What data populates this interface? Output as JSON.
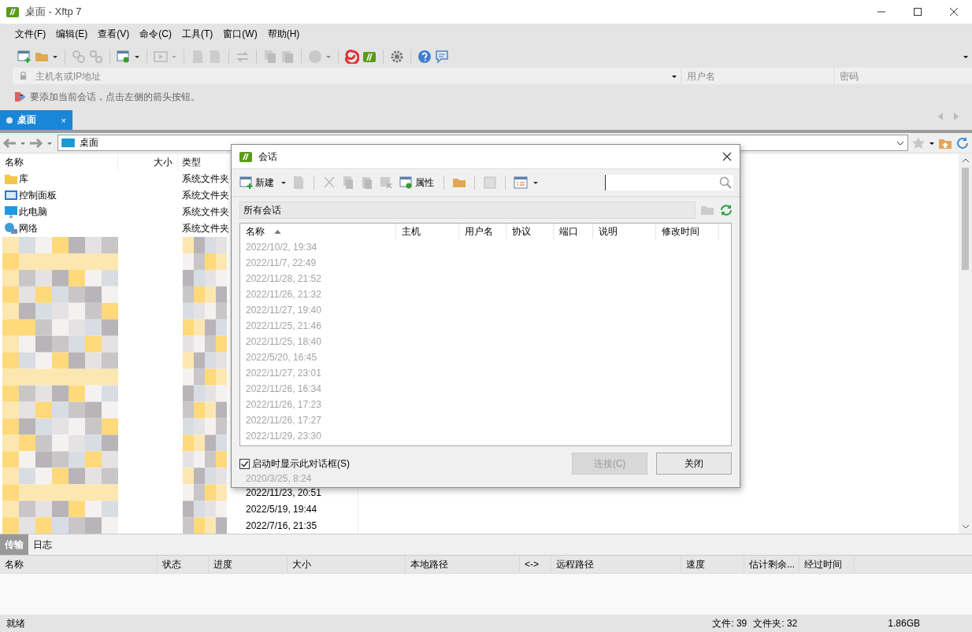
{
  "window": {
    "title": "桌面 - Xftp 7"
  },
  "menu": [
    "文件(F)",
    "编辑(E)",
    "查看(V)",
    "命令(C)",
    "工具(T)",
    "窗口(W)",
    "帮助(H)"
  ],
  "connect_bar": {
    "host_placeholder": "主机名或IP地址",
    "user_placeholder": "用户名",
    "password_placeholder": "密码"
  },
  "hint": "要添加当前会话，点击左侧的箭头按钮。",
  "session_tabs": [
    {
      "label": "桌面",
      "selected": true,
      "close": "×"
    }
  ],
  "path": "桌面",
  "file_list": {
    "columns": [
      "名称",
      "大小",
      "类型"
    ],
    "rows": [
      {
        "name": "库",
        "type": "系统文件夹",
        "kind": "folder"
      },
      {
        "name": "控制面板",
        "type": "系统文件夹",
        "kind": "control-panel"
      },
      {
        "name": "此电脑",
        "type": "系统文件夹",
        "kind": "computer"
      },
      {
        "name": "网络",
        "type": "系统文件夹",
        "kind": "network"
      }
    ],
    "modified_dates": [
      "2022/11/23, 20:51",
      "2022/5/19, 19:44",
      "2022/7/16, 21:35"
    ]
  },
  "dialog": {
    "title": "会话",
    "new_label": "新建",
    "properties_label": "属性",
    "folder": "所有会话",
    "columns": [
      {
        "label": "名称",
        "sorted": true
      },
      {
        "label": "主机",
        "sorted": false
      },
      {
        "label": "用户名",
        "sorted": false
      },
      {
        "label": "协议",
        "sorted": false
      },
      {
        "label": "端口",
        "sorted": false
      },
      {
        "label": "说明",
        "sorted": false
      },
      {
        "label": "修改时间",
        "sorted": false
      }
    ],
    "ghost_dates": [
      "2022/10/2, 19:34",
      "2022/11/7, 22:49",
      "2022/11/28, 21:52",
      "2022/11/26, 21:32",
      "2022/11/27, 19:40",
      "2022/11/25, 21:46",
      "2022/11/25, 18:40",
      "2022/5/20, 16:45",
      "2022/11/27, 23:01",
      "2022/11/26, 16:34",
      "2022/11/26, 17:23",
      "2022/11/26, 17:27",
      "2022/11/29, 23:30"
    ],
    "footer_ghost_date": "2020/3/25, 8:24",
    "show_on_startup": {
      "label": "启动时显示此对话框(S)",
      "checked": true
    },
    "buttons": [
      {
        "label": "连接(C)",
        "disabled": true
      },
      {
        "label": "关闭",
        "disabled": false
      }
    ]
  },
  "transfer_tabs": [
    {
      "label": "传输",
      "selected": true
    },
    {
      "label": "日志",
      "selected": false
    }
  ],
  "transfer_columns": [
    "名称",
    "状态",
    "进度",
    "大小",
    "本地路径",
    "<->",
    "远程路径",
    "速度",
    "估计剩余...",
    "经过时间"
  ],
  "status_bar": {
    "text": "就绪",
    "files": "文件: 39",
    "folders": "文件夹: 32",
    "size": "1.86GB"
  }
}
